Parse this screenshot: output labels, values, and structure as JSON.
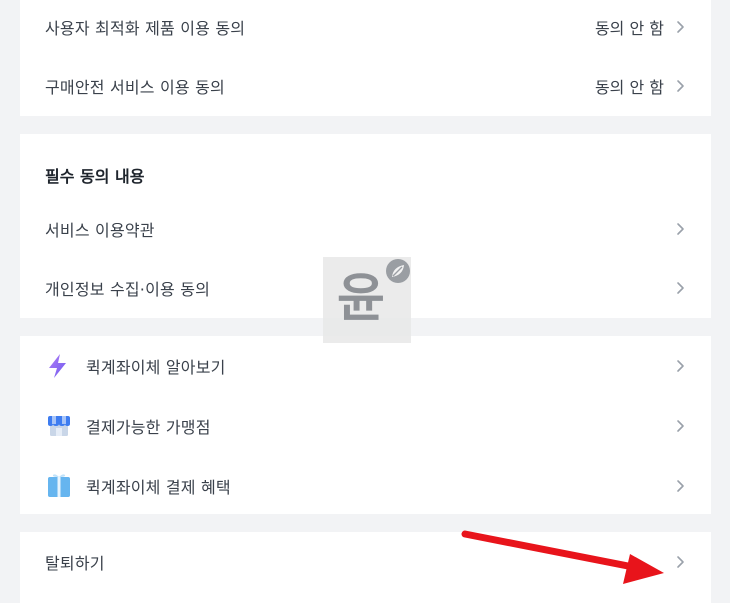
{
  "consent_rows": [
    {
      "label": "사용자 최적화 제품 이용 동의",
      "value": "동의 안 함"
    },
    {
      "label": "구매안전 서비스 이용 동의",
      "value": "동의 안 함"
    }
  ],
  "required": {
    "title": "필수 동의 내용",
    "items": [
      {
        "label": "서비스 이용약관"
      },
      {
        "label": "개인정보 수집·이용 동의"
      }
    ]
  },
  "quick": {
    "items": [
      {
        "label": "퀵계좌이체 알아보기",
        "icon": "lightning-icon"
      },
      {
        "label": "결제가능한 가맹점",
        "icon": "store-icon"
      },
      {
        "label": "퀵계좌이체 결제 혜택",
        "icon": "gift-icon"
      }
    ]
  },
  "withdraw": {
    "label": "탈퇴하기"
  },
  "watermark": {
    "text": "윤"
  },
  "colors": {
    "accent_arrow": "#e8141b",
    "background": "#f2f3f5",
    "card": "#ffffff"
  }
}
